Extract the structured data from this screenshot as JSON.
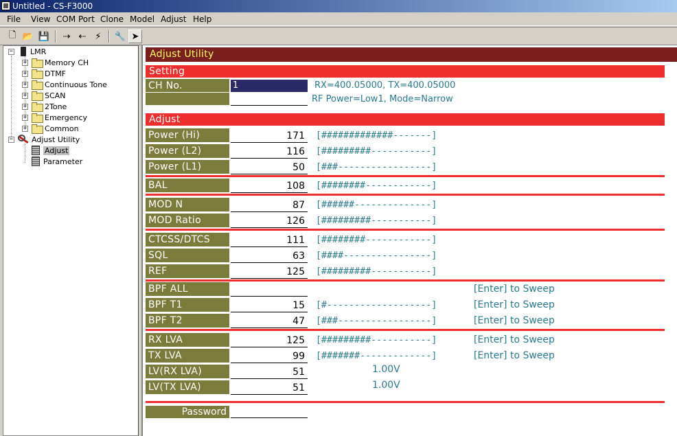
{
  "window": {
    "title": "Untitled - CS-F3000"
  },
  "menu": [
    "File",
    "View",
    "COM Port",
    "Clone",
    "Model",
    "Adjust",
    "Help"
  ],
  "toolbar": {
    "buttons": [
      "new-icon",
      "open-icon",
      "save-icon",
      "read-radio-icon",
      "write-radio-icon",
      "clone-icon",
      "adjust-icon",
      "select-icon"
    ]
  },
  "tree": {
    "root": "LMR",
    "items": [
      "Memory CH",
      "DTMF",
      "Continuous Tone",
      "SCAN",
      "2Tone",
      "Emergency",
      "Common"
    ],
    "adjust_utility": "Adjust Utility",
    "adjust_children": [
      "Adjust",
      "Parameter"
    ]
  },
  "main": {
    "header": "Adjust Utility",
    "setting": {
      "title": "Setting",
      "ch_label": "CH No.",
      "ch_value": "1",
      "freq_info": "RX=400.05000, TX=400.05000",
      "mode_info": "RF Power=Low1, Mode=Narrow"
    },
    "adjust": {
      "title": "Adjust",
      "rows": [
        {
          "label": "Power (Hi)",
          "value": "171",
          "bar": "[#############-------]"
        },
        {
          "label": "Power (L2)",
          "value": "116",
          "bar": "[#########-----------]"
        },
        {
          "label": "Power (L1)",
          "value": "50",
          "bar": "[###-----------------]"
        },
        {
          "label": "BAL",
          "value": "108",
          "bar": "[########------------]"
        },
        {
          "label": "MOD N",
          "value": "87",
          "bar": "[######--------------]"
        },
        {
          "label": "MOD Ratio",
          "value": "126",
          "bar": "[#########-----------]"
        },
        {
          "label": "CTCSS/DTCS",
          "value": "111",
          "bar": "[########------------]"
        },
        {
          "label": "SQL",
          "value": "63",
          "bar": "[####----------------]"
        },
        {
          "label": "REF",
          "value": "125",
          "bar": "[#########-----------]"
        },
        {
          "label": "BPF ALL",
          "value": "",
          "bar": "",
          "sweep": "[Enter] to Sweep"
        },
        {
          "label": "BPF T1",
          "value": "15",
          "bar": "[#-------------------]",
          "sweep": "[Enter] to Sweep"
        },
        {
          "label": "BPF T2",
          "value": "47",
          "bar": "[###-----------------]",
          "sweep": "[Enter] to Sweep"
        },
        {
          "label": "RX LVA",
          "value": "125",
          "bar": "[#########-----------]",
          "sweep": "[Enter] to Sweep"
        },
        {
          "label": "TX LVA",
          "value": "99",
          "bar": "[#######-------------]",
          "sweep": "[Enter] to Sweep"
        },
        {
          "label": "LV(RX LVA)",
          "value": "51",
          "volt": "1.00V"
        },
        {
          "label": "LV(TX LVA)",
          "value": "51",
          "volt": "1.00V"
        }
      ]
    },
    "password_label": "Password",
    "password_value": ""
  },
  "colors": {
    "header_bg": "#7a1e1e",
    "header_text": "#ffff66",
    "section_red": "#ee2d2d",
    "label_olive": "#7b7b3c",
    "info_teal": "#2a7a8e",
    "selected_input": "#2a2a66"
  }
}
